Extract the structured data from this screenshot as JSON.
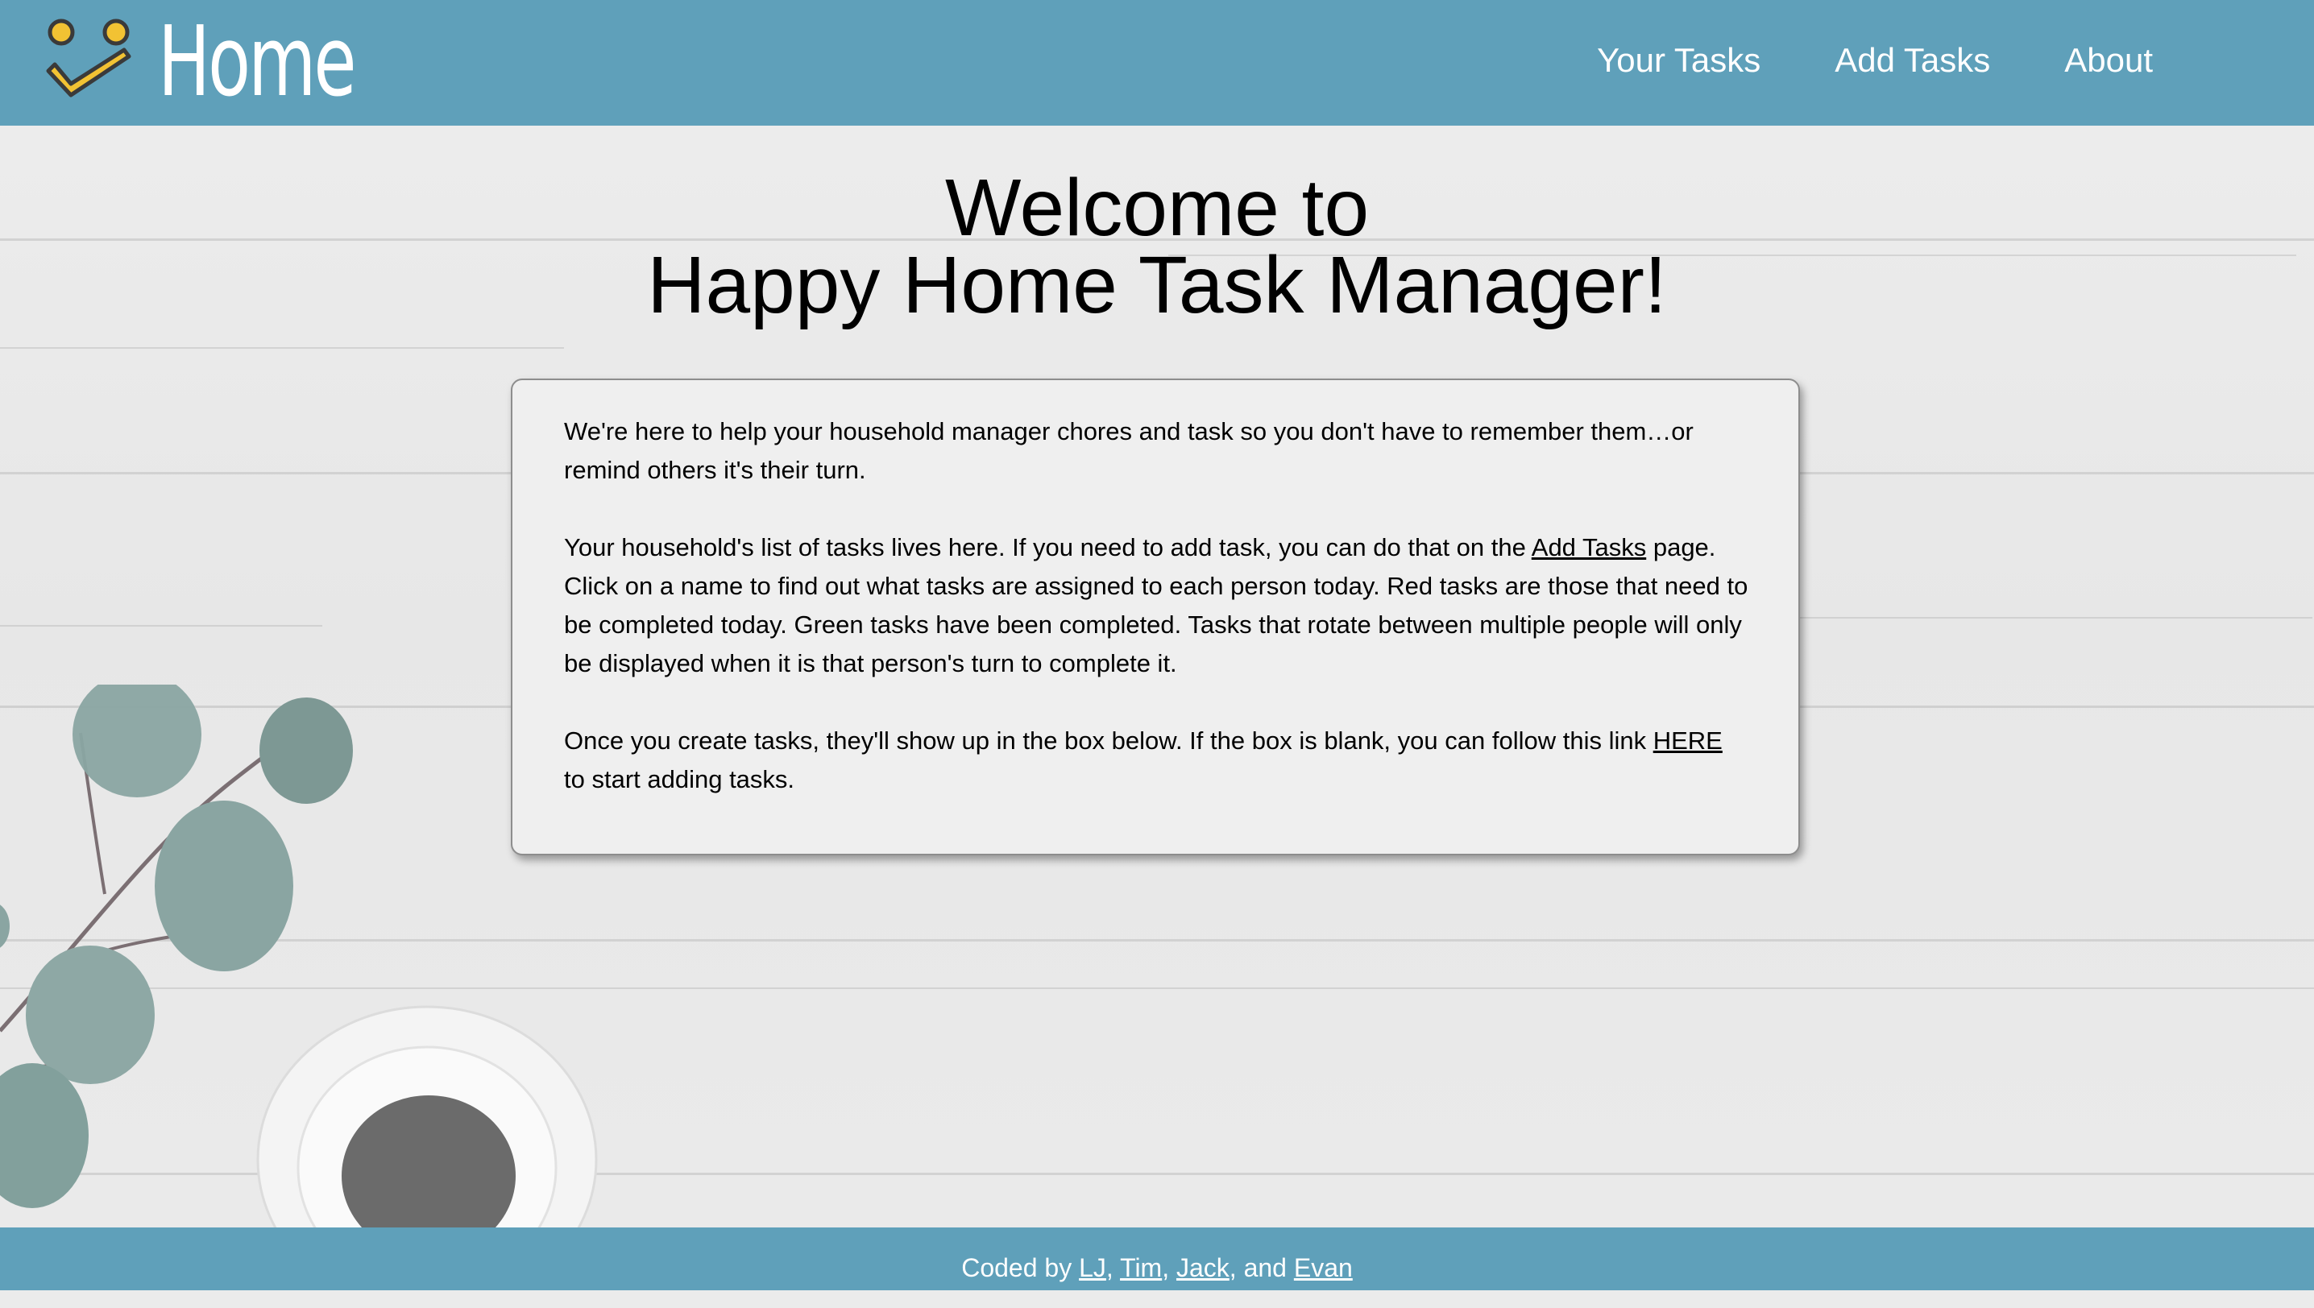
{
  "header": {
    "brand": "Home",
    "logo_icon": "smiley-check-icon",
    "nav": {
      "your_tasks": "Your Tasks",
      "add_tasks": "Add Tasks",
      "about": "About"
    }
  },
  "main": {
    "title_line1": "Welcome to",
    "title_line2": "Happy Home Task Manager!",
    "card": {
      "p1": "We're here to help your household manager chores and task so you don't have to remember them…or remind others it's their turn.",
      "p2_before": "Your household's list of tasks lives here. If you need to add task, you can do that on the ",
      "p2_link": "Add Tasks",
      "p2_after": " page. Click on a name to find out what tasks are assigned to each person today. Red tasks are those that need to be completed today. Green tasks have been completed. Tasks that rotate between multiple people will only be displayed when it is that person's turn to complete it.",
      "p3_before": "Once you create tasks, they'll show up in the box below. If the box is blank, you can follow this link ",
      "p3_link": "HERE",
      "p3_after": " to start adding tasks."
    }
  },
  "footer": {
    "prefix": "Coded by ",
    "author1": "LJ",
    "sep1": ", ",
    "author2": "Tim",
    "sep2": ", ",
    "author3": "Jack",
    "sep3": ", and ",
    "author4": "Evan"
  },
  "colors": {
    "bar": "#5fa0ba",
    "logo_yellow": "#f2c233",
    "card_bg": "#efefef"
  }
}
